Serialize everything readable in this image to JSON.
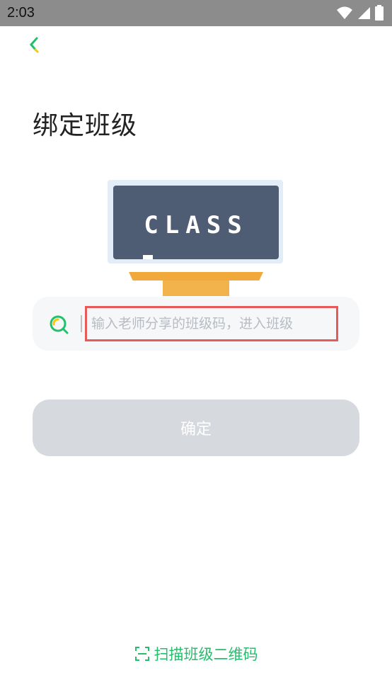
{
  "status_bar": {
    "time": "2:03"
  },
  "header": {
    "title": "绑定班级"
  },
  "illustration": {
    "board_text": "CLASS"
  },
  "search": {
    "placeholder": "输入老师分享的班级码，进入班级",
    "value": ""
  },
  "confirm": {
    "label": "确定"
  },
  "scan": {
    "label": "扫描班级二维码"
  },
  "colors": {
    "accent": "#22c06a",
    "highlight_border": "#e85a5a",
    "disabled_button": "#d6d9dd",
    "board": "#4f5d74",
    "desk": "#f2a93b"
  }
}
